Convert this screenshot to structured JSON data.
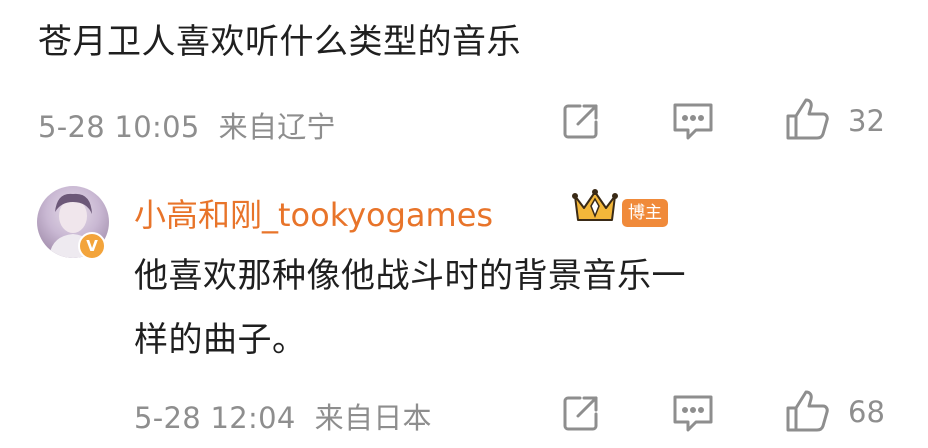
{
  "post": {
    "text": "苍月卫人喜欢听什么类型的音乐",
    "meta": "5-28 10:05  来自辽宁",
    "like_count": "32"
  },
  "reply": {
    "username": "小高和刚_tookyogames",
    "badge": "博主",
    "verified_mark": "V",
    "text_line1": "他喜欢那种像他战斗时的背景音乐一",
    "text_line2": "样的曲子。",
    "meta": "5-28 12:04  来自日本",
    "like_count": "68"
  },
  "icons": {
    "share": "share-icon",
    "comment": "comment-icon",
    "like": "like-icon",
    "crown": "crown-icon"
  },
  "colors": {
    "username": "#e8742a",
    "badge_bg": "#f08a3a",
    "meta_text": "#8e8e8e"
  }
}
